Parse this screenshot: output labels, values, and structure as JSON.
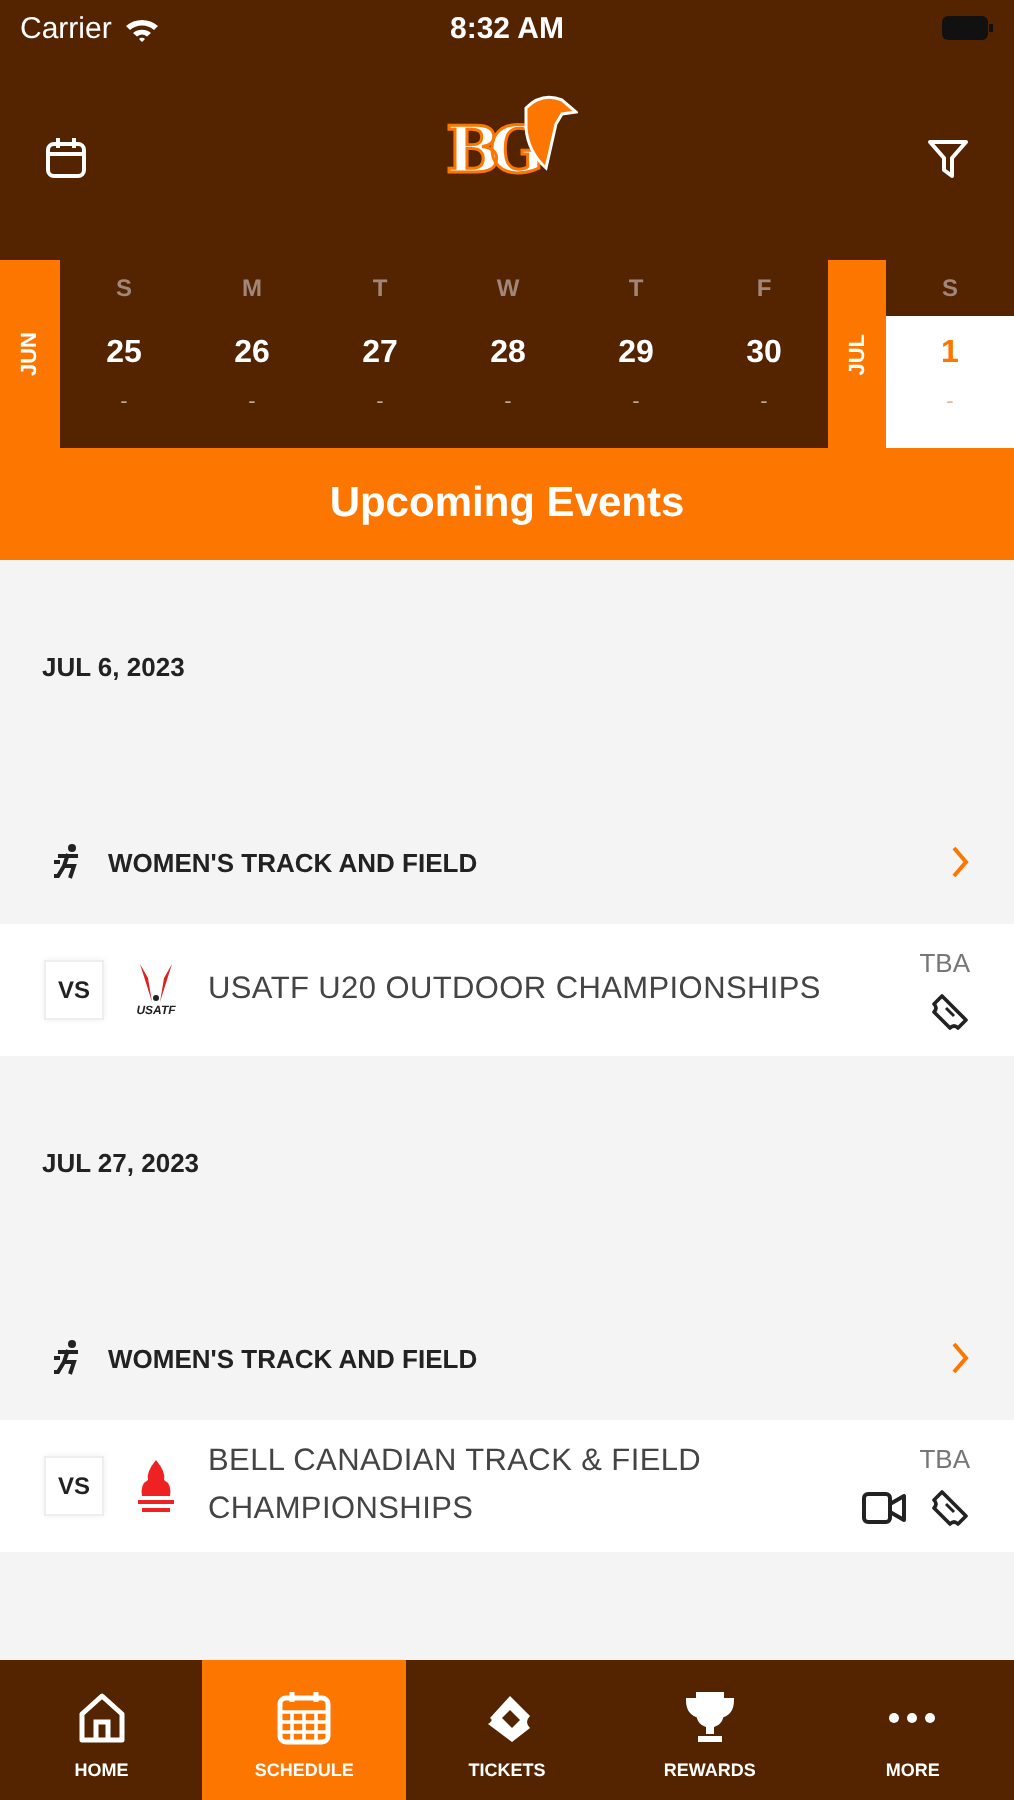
{
  "status_bar": {
    "carrier": "Carrier",
    "time": "8:32 AM"
  },
  "header": {
    "logo": "BG"
  },
  "week": [
    {
      "month": "JUN",
      "days": [
        {
          "weekday": "S",
          "date": "25",
          "events": "-",
          "selected": false
        },
        {
          "weekday": "M",
          "date": "26",
          "events": "-",
          "selected": false
        },
        {
          "weekday": "T",
          "date": "27",
          "events": "-",
          "selected": false
        },
        {
          "weekday": "W",
          "date": "28",
          "events": "-",
          "selected": false
        },
        {
          "weekday": "T",
          "date": "29",
          "events": "-",
          "selected": false
        },
        {
          "weekday": "F",
          "date": "30",
          "events": "-",
          "selected": false
        }
      ]
    },
    {
      "month": "JUL",
      "days": [
        {
          "weekday": "S",
          "date": "1",
          "events": "-",
          "selected": true
        }
      ]
    }
  ],
  "section_title": "Upcoming Events",
  "event_groups": [
    {
      "date": "JUL 6, 2023",
      "sport": "WOMEN'S TRACK AND FIELD",
      "event": {
        "vs": "VS",
        "logo_caption": "USATF",
        "title": "USATF U20 OUTDOOR CHAMPIONSHIPS",
        "time": "TBA",
        "video": false,
        "tickets": true
      }
    },
    {
      "date": "JUL 27, 2023",
      "sport": "WOMEN'S TRACK AND FIELD",
      "event": {
        "vs": "VS",
        "title": "BELL CANADIAN TRACK & FIELD CHAMPIONSHIPS",
        "time": "TBA",
        "video": true,
        "tickets": true
      }
    }
  ],
  "tab_bar": [
    {
      "label": "HOME",
      "selected": false
    },
    {
      "label": "SCHEDULE",
      "selected": true
    },
    {
      "label": "TICKETS",
      "selected": false
    },
    {
      "label": "REWARDS",
      "selected": false
    },
    {
      "label": "MORE",
      "selected": false
    }
  ]
}
